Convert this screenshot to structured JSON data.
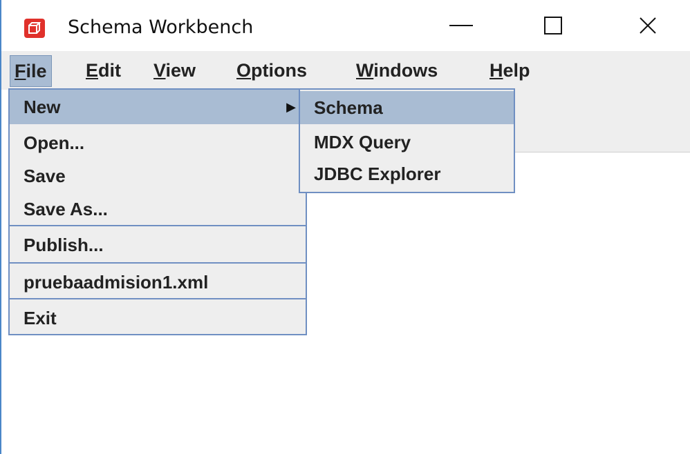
{
  "window": {
    "title": "Schema Workbench",
    "app_icon": "cube-icon",
    "controls": [
      "minimize-icon",
      "maximize-icon",
      "close-icon"
    ]
  },
  "menubar": {
    "items": [
      {
        "label": "File",
        "mnemonic": "F",
        "rest": "ile",
        "active": true
      },
      {
        "label": "Edit",
        "mnemonic": "E",
        "rest": "dit"
      },
      {
        "label": "View",
        "mnemonic": "V",
        "rest": "iew"
      },
      {
        "label": "Options",
        "mnemonic": "O",
        "rest": "ptions"
      },
      {
        "label": "Windows",
        "mnemonic": "W",
        "rest": "indows"
      },
      {
        "label": "Help",
        "mnemonic": "H",
        "rest": "elp"
      }
    ]
  },
  "file_menu": {
    "items": [
      {
        "label": "New",
        "submenu": true,
        "highlighted": true
      },
      {
        "label": "Open..."
      },
      {
        "label": "Save"
      },
      {
        "label": "Save As..."
      },
      {
        "label": "Publish..."
      },
      {
        "label": "pruebaadmision1.xml"
      },
      {
        "label": "Exit"
      }
    ]
  },
  "new_submenu": {
    "items": [
      {
        "label": "Schema",
        "highlighted": true
      },
      {
        "label": "MDX Query"
      },
      {
        "label": "JDBC Explorer"
      }
    ]
  },
  "colors": {
    "highlight": "#a9bcd3",
    "menu_bg": "#eeeeee",
    "border": "#6f8fc2",
    "app_icon": "#e0312b"
  }
}
